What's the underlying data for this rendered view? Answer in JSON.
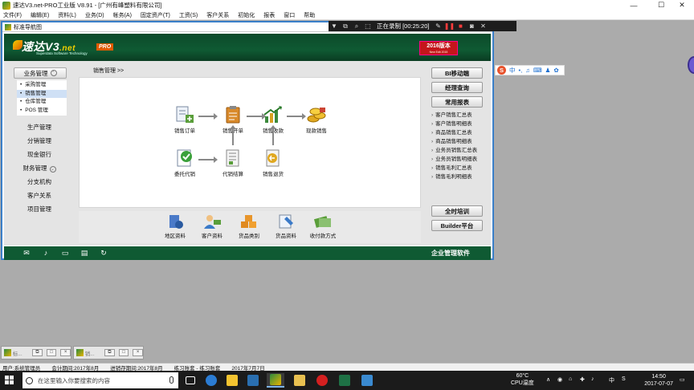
{
  "window": {
    "title": "速达V3.net-PRO工业版 V8.91 - [广州有峰塑料有限公司]",
    "controls": {
      "minimize": "—",
      "maximize": "☐",
      "close": "✕"
    }
  },
  "menubar": {
    "items": [
      "文件(F)",
      "编辑(E)",
      "资料(L)",
      "业务(D)",
      "帐务(A)",
      "固定资产(T)",
      "工资(S)",
      "客户关系",
      "初始化",
      "报表",
      "窗口",
      "帮助"
    ]
  },
  "recorder": {
    "status": "正在录制 [00:25:20]"
  },
  "child_window": {
    "title": "标准导航图"
  },
  "banner": {
    "logo_main": "速达V3",
    "logo_net": ".net",
    "logo_sub": "Superdata Software Technology",
    "pro": "PRO",
    "version": "2016版本",
    "version_sub": "New Edit 2015"
  },
  "leftnav": {
    "active_module": "业务管理",
    "sub_items": [
      "采购管理",
      "销售管理",
      "仓库管理",
      "POS 管理"
    ],
    "selected_sub": 1,
    "modules": [
      "生产管理",
      "分销管理",
      "现金银行",
      "财务管理",
      "分支机构",
      "客户关系",
      "项目管理"
    ]
  },
  "breadcrumb": "销售管理 >>",
  "flow": {
    "sales_order": "销售订单",
    "sales_invoice": "销售开单",
    "sales_receipt": "销售收款",
    "cash_sales": "现款销售",
    "consignment": "委托代销",
    "consign_settle": "代销结算",
    "sales_return": "销售退货"
  },
  "bottom_items": [
    "地区资料",
    "客户资料",
    "货品类别",
    "货品资料",
    "收付款方式"
  ],
  "right_panel": {
    "buttons": [
      "BI移动端",
      "经理查询",
      "常用报表"
    ],
    "links": [
      "客户销售汇总表",
      "客户销售明细表",
      "商品销售汇总表",
      "商品销售明细表",
      "业务员销售汇总表",
      "业务员销售明细表",
      "销售毛利汇总表",
      "销售毛利明细表"
    ],
    "bottom_buttons": [
      "全时培训",
      "Builder平台"
    ]
  },
  "footer": {
    "text": "企业管理软件"
  },
  "ime": {
    "label": "中"
  },
  "minimized_windows": [
    {
      "title": "标..."
    },
    {
      "title": "销..."
    }
  ],
  "statusbar": {
    "user": "用户:系统管理员",
    "accounting_period": "会计期间:2017年8月",
    "inventory_period": "进销存期间:2017年8月",
    "account_set": "练习账套 - 练习账套",
    "date": "2017年7月7日"
  },
  "taskbar": {
    "search_placeholder": "在这里输入你要搜索的内容",
    "temp": "60°C",
    "temp_label": "CPU温度",
    "tray_lang": "中",
    "time": "14:50",
    "date": "2017-07-07"
  },
  "colors": {
    "brand_green": "#0f5a33",
    "accent_orange": "#e05a00",
    "version_red": "#c4151b",
    "window_border": "#3a7fc9"
  }
}
